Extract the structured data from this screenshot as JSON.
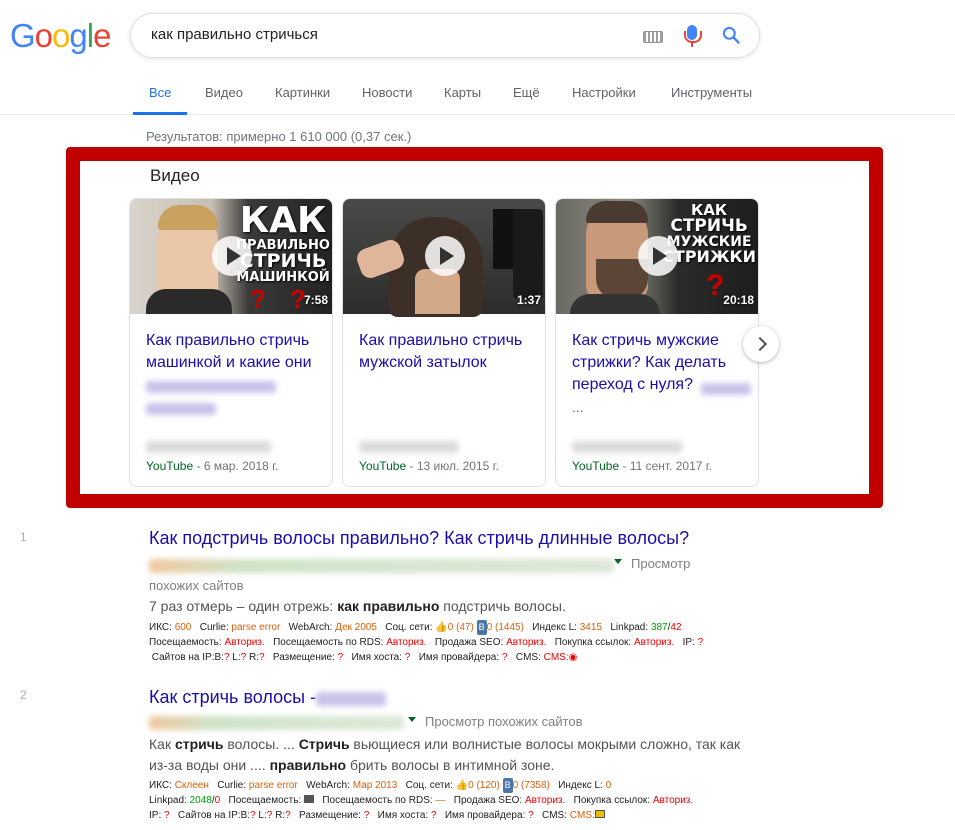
{
  "header": {
    "logo": "Google",
    "search_query": "как правильно стричься",
    "logo_colors": [
      "#4285f4",
      "#ea4335",
      "#fbbc05",
      "#4285f4",
      "#34a853",
      "#ea4335"
    ]
  },
  "tabs": [
    {
      "label": "Все",
      "active": true
    },
    {
      "label": "Видео"
    },
    {
      "label": "Картинки"
    },
    {
      "label": "Новости"
    },
    {
      "label": "Карты"
    },
    {
      "label": "Ещё"
    },
    {
      "label": "Настройки"
    },
    {
      "label": "Инструменты"
    }
  ],
  "result_stats": "Результатов: примерно 1 610 000 (0,37 сек.)",
  "videos": {
    "heading": "Видео",
    "items": [
      {
        "thumb_text": "КАК\nПРАВИЛЬНО\nСТРИЧЬ\nМАШИНКОЙ",
        "duration": "7:58",
        "title": "Как правильно стричь машинкой и какие они",
        "source": "YouTube",
        "date": " - 6 мар. 2018 г."
      },
      {
        "thumb_text": "",
        "duration": "1:37",
        "title": "Как правильно стричь мужской затылок",
        "source": "YouTube",
        "date": " - 13 июл. 2015 г."
      },
      {
        "thumb_text": "КАК\nСТРИЧЬ\nМУЖСКИЕ\nСТРИЖКИ",
        "duration": "20:18",
        "title": "Как стричь мужские стрижки? Как делать переход с нуля?",
        "ellipsis": "...",
        "source": "YouTube",
        "date": " - 11 сент. 2017 г."
      }
    ]
  },
  "results": [
    {
      "num": "1",
      "title": "Как подстричь волосы правильно? Как стричь длинные волосы?",
      "similar_1": "Просмотр",
      "similar_2": "похожих сайтов",
      "snippet_pre": "7 раз отмерь – один отрежь: ",
      "snippet_bold": "как правильно",
      "snippet_post": " подстричь волосы.",
      "seo": {
        "line1": [
          "ИКС:",
          "600",
          "Curlie:",
          "parse error",
          "WebArch:",
          "Дек 2005",
          "Соц. сети:",
          "0 (47)",
          "В",
          "0 (1445)",
          "Индекс L:",
          "3415",
          "Linkpad:",
          "387",
          "/",
          "42"
        ],
        "line2": [
          "Посещаемость:",
          "Авториз.",
          "Посещаемость по RDS:",
          "Авториз.",
          "Продажа SEO:",
          "Авториз.",
          "Покупка ссылок:",
          "Авториз.",
          "IP:",
          "?"
        ],
        "line3": [
          "Сайтов на IP:",
          "B:",
          "?",
          "L:",
          "?",
          "R:",
          "?",
          "Размещение:",
          "?",
          "Имя хоста:",
          "?",
          "Имя провайдера:",
          "?",
          "CMS:",
          "CMS:"
        ]
      }
    },
    {
      "num": "2",
      "title": "Как стричь волосы -",
      "similar": "Просмотр похожих сайтов",
      "snippet_1a": "Как ",
      "snippet_1b": "стричь",
      "snippet_1c": " волосы. ... ",
      "snippet_1d": "Стричь",
      "snippet_1e": " вьющиеся или волнистые волосы мокрыми сложно, так как",
      "snippet_2a": "из-за воды они .... ",
      "snippet_2b": "правильно",
      "snippet_2c": " брить волосы в интимной зоне.",
      "seo": {
        "line1": [
          "ИКС:",
          "Склеен",
          "Curlie:",
          "parse error",
          "WebArch:",
          "Мар 2013",
          "Соц. сети:",
          "0 (120)",
          "В",
          "0 (7358)",
          "Индекс L:",
          "0"
        ],
        "line2": [
          "Linkpad:",
          "2048",
          "/",
          "0",
          "Посещаемость:",
          "Посещаемость по RDS:",
          "—",
          "Продажа SEO:",
          "Авториз.",
          "Покупка ссылок:",
          "Авториз."
        ],
        "line3": [
          "IP:",
          "?",
          "Сайтов на IP:",
          "B:",
          "?",
          "L:",
          "?",
          "R:",
          "?",
          "Размещение:",
          "?",
          "Имя хоста:",
          "?",
          "Имя провайдера:",
          "?",
          "CMS:",
          "CMS:"
        ]
      }
    }
  ]
}
